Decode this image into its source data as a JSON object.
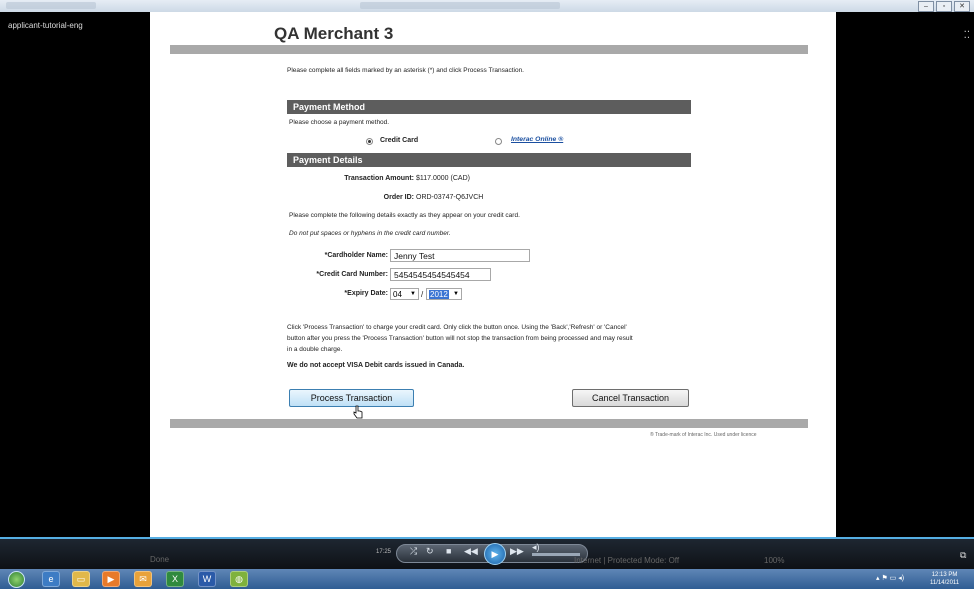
{
  "window": {
    "sidebar_label": "applicant-tutorial-eng"
  },
  "page": {
    "merchant_title": "QA Merchant 3",
    "intro": "Please complete all fields marked by an asterisk (*) and click Process Transaction.",
    "payment_method": {
      "heading": "Payment Method",
      "prompt": "Please choose a payment method.",
      "options": [
        {
          "label": "Credit Card",
          "selected": true
        },
        {
          "label": "Interac Online ®",
          "selected": false
        }
      ]
    },
    "payment_details": {
      "heading": "Payment Details",
      "amount_label": "Transaction Amount:",
      "amount_value": "$117.0000 (CAD)",
      "order_label": "Order ID:",
      "order_value": "ORD-03747-Q6JVCH",
      "instructions": "Please complete the following details exactly as they appear on your credit card.",
      "note": "Do not put spaces or hyphens in the credit card number.",
      "cardholder_label": "*Cardholder Name:",
      "cardholder_value": "Jenny Test",
      "card_number_label": "*Credit Card Number:",
      "card_number_value": "5454545454545454",
      "expiry_label": "*Expiry Date:",
      "expiry_month": "04",
      "expiry_sep": "/",
      "expiry_year": "2012"
    },
    "warning_line1": "Click 'Process Transaction' to charge your credit card. Only click the button once. Using the 'Back','Refresh' or 'Cancel'",
    "warning_line2": "button after you press the 'Process Transaction' button will not stop the transaction from being processed and may result",
    "warning_line3": "in a double charge.",
    "visa_note": "We do not accept VISA Debit cards issued in Canada.",
    "process_button": "Process Transaction",
    "cancel_button": "Cancel Transaction",
    "trademark": "® Trade-mark of Interac Inc. Used under licence"
  },
  "media_bar": {
    "time": "17:25",
    "status_left": "Done",
    "mode_text": "Internet | Protected Mode: Off",
    "zoom": "100%"
  },
  "taskbar": {
    "clock_time": "12:13 PM",
    "clock_date": "11/14/2011"
  },
  "colors": {
    "section_header": "#5d5d5d",
    "accent_blue": "#3a74d3",
    "taskbar": "#2f5d93"
  }
}
